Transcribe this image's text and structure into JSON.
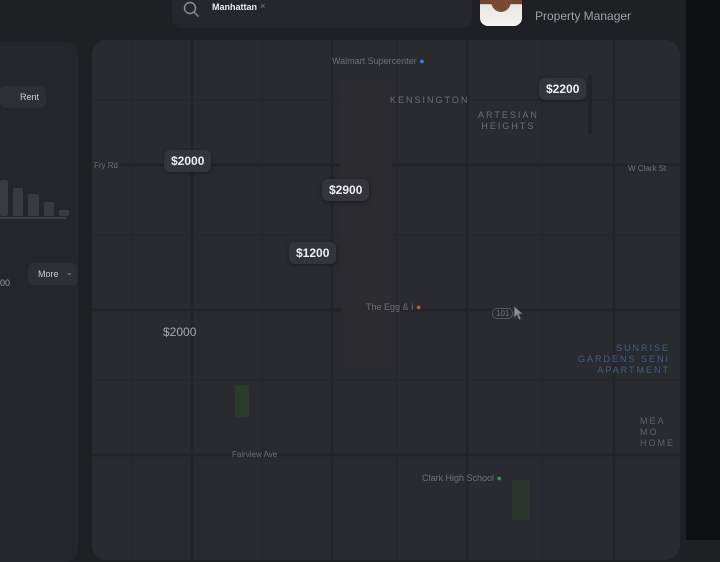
{
  "search": {
    "chip_label": "Manhattan",
    "chip_remove": "×"
  },
  "user": {
    "role": "Property Manager"
  },
  "left_panel": {
    "rent_label": "Rent",
    "axis_tick": "00",
    "more_label": "More",
    "bars": [
      0.85,
      0.7,
      0.55,
      0.35,
      0.2
    ]
  },
  "map": {
    "area_labels": {
      "kensington": "KENSINGTON",
      "artesian": "ARTESIAN\nHEIGHTS"
    },
    "pois": {
      "walmart": "Walmart Supercenter",
      "egg": "The Egg & I",
      "clark": "Clark High School"
    },
    "blue_area": "SUNRISE\nGARDENS SENI\nAPARTMENT",
    "gray_area": "MEA\nMO\nHOME",
    "streets": {
      "fairview": "Fairview Ave",
      "clark_st": "W Clark St",
      "hwy": "101",
      "fry": "Fry Rd"
    },
    "price_markers": [
      {
        "id": "p1",
        "label": "$2200"
      },
      {
        "id": "p2",
        "label": "$2000"
      },
      {
        "id": "p3",
        "label": "$2900"
      },
      {
        "id": "p4",
        "label": "$1200"
      },
      {
        "id": "p5",
        "label": "$2000"
      }
    ]
  },
  "colors": {
    "background": "#1f2024",
    "map": "#2a2b30",
    "marker": "#34353b",
    "accent_poi": "#3f7fd0",
    "marker_poi": "#c8572f"
  }
}
